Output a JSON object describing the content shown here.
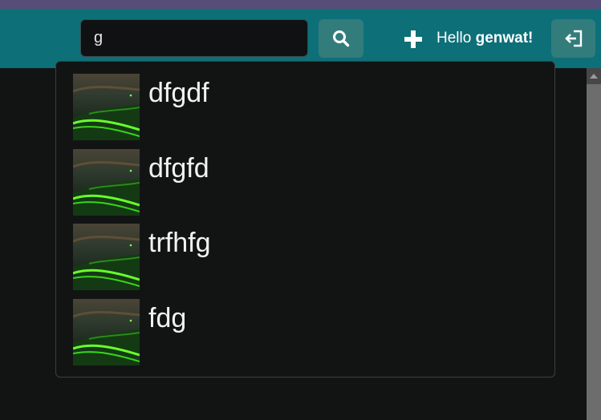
{
  "header": {
    "search": {
      "value": "g",
      "placeholder": ""
    },
    "search_button_icon": "search-icon",
    "add_button_icon": "plus-icon",
    "greeting_prefix": "Hello",
    "username": "genwat!",
    "logout_icon": "logout-icon"
  },
  "results": [
    {
      "label": "dfgdf",
      "thumbnail": "green-wave-image"
    },
    {
      "label": "dfgfd",
      "thumbnail": "green-wave-image"
    },
    {
      "label": "trfhfg",
      "thumbnail": "green-wave-image"
    },
    {
      "label": "fdg",
      "thumbnail": "green-wave-image"
    }
  ],
  "colors": {
    "top_strip": "#564e78",
    "header": "#0d6f78",
    "button": "#337c7c",
    "background": "#121414"
  }
}
